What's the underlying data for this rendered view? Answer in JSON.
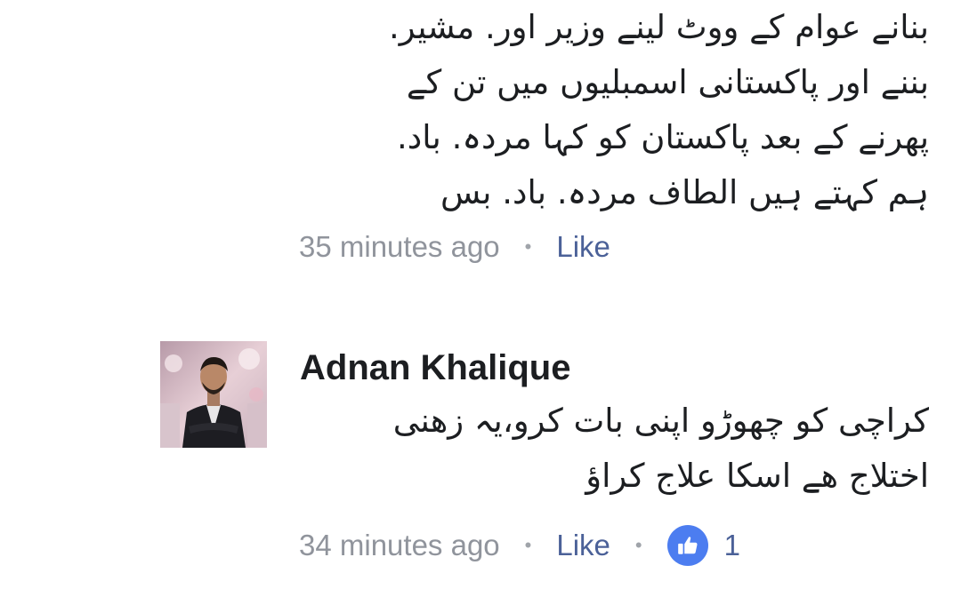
{
  "comments": [
    {
      "text_lines": [
        "بنانے عوام کے ووٹ لینے وزیر اور. مشیر.",
        "بننے اور پاکستانی اسمبلیوں میں تن کے",
        "پھرنے کے بعد پاکستان کو کہا مردہ. باد.",
        "ہم کہتے ہیں الطاف مردہ. باد. بس"
      ],
      "timestamp": "35 minutes ago",
      "separator": "•",
      "like_label": "Like"
    },
    {
      "author": "Adnan Khalique",
      "avatar_icon": "profile-photo",
      "text_lines": [
        "کراچی کو چھوڑو  اپنی بات کرو،یہ زھنی",
        "اختلاج ھے اسکا علاج کراؤ"
      ],
      "timestamp": "34 minutes ago",
      "separator": "•",
      "like_label": "Like",
      "reaction_icon": "thumbs-up-icon",
      "reaction_count": "1"
    }
  ],
  "colors": {
    "text": "#1c1e21",
    "meta": "#90949c",
    "link": "#4b6198",
    "reaction": "#4c7df0"
  }
}
